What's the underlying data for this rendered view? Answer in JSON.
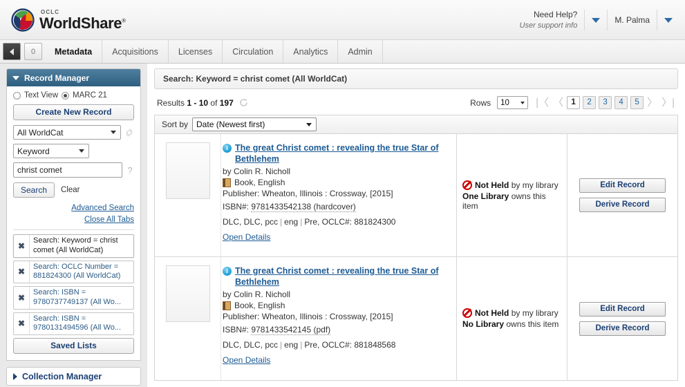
{
  "header": {
    "logo": {
      "brand_top": "OCLC",
      "brand_main": "WorldShare",
      "tm": "®"
    },
    "need_help": {
      "line1": "Need Help?",
      "line2": "User support info"
    },
    "user": "M. Palma",
    "chevron_icon": "chevron-down-icon"
  },
  "nav": {
    "collapse_icon": "chevron-left-icon",
    "counter": "0",
    "tabs": [
      {
        "label": "Metadata",
        "active": true
      },
      {
        "label": "Acquisitions",
        "active": false
      },
      {
        "label": "Licenses",
        "active": false
      },
      {
        "label": "Circulation",
        "active": false
      },
      {
        "label": "Analytics",
        "active": false
      },
      {
        "label": "Admin",
        "active": false
      }
    ]
  },
  "sidebar": {
    "record_manager": {
      "title": "Record Manager",
      "view_options": [
        {
          "label": "Text View",
          "selected": false
        },
        {
          "label": "MARC 21",
          "selected": true
        }
      ],
      "create_button": "Create New Record",
      "database_select": "All WorldCat",
      "gear_icon": "gear-icon",
      "index_select": "Keyword",
      "search_value": "christ comet",
      "help_icon": "question-mark-icon",
      "search_button": "Search",
      "clear_button": "Clear",
      "advanced_search": "Advanced Search",
      "close_all_tabs": "Close All Tabs",
      "saved_searches": [
        {
          "label": "Search: Keyword = christ comet (All WorldCat)",
          "active": true,
          "close_icon": "close-icon"
        },
        {
          "label": "Search: OCLC Number = 881824300 (All WorldCat)",
          "active": false,
          "close_icon": "close-icon"
        },
        {
          "label": "Search: ISBN = 9780737749137 (All Wo...",
          "active": false,
          "close_icon": "close-icon"
        },
        {
          "label": "Search: ISBN = 9780131494596 (All Wo...",
          "active": false,
          "close_icon": "close-icon"
        }
      ],
      "saved_lists_button": "Saved Lists"
    },
    "collection_manager": {
      "title": "Collection Manager",
      "expand_icon": "triangle-right-icon"
    }
  },
  "main": {
    "search_summary": "Search: Keyword = christ comet (All WorldCat)",
    "results_label_prefix": "Results",
    "results_range": "1 - 10",
    "results_of": "of",
    "results_total": "197",
    "refresh_icon": "refresh-icon",
    "rows_label": "Rows",
    "rows_value": "10",
    "pagination": {
      "first_icon": "first-page-icon",
      "prev_icon": "prev-page-icon",
      "pages": [
        "1",
        "2",
        "3",
        "4",
        "5"
      ],
      "current_page": "1",
      "next_icon": "next-page-icon",
      "last_icon": "last-page-icon"
    },
    "sort_label": "Sort by",
    "sort_value": "Date (Newest first)",
    "results": [
      {
        "info_icon": "info-icon",
        "cover_placeholder": "no-cover-image",
        "title": "The great Christ comet : revealing the true Star of Bethlehem",
        "author": "by Colin R. Nicholl",
        "format_icon": "book-icon",
        "format": "Book, English",
        "publisher": "Publisher: Wheaton, Illinois : Crossway, [2015]",
        "isbn_label": "ISBN#:",
        "isbn_value": "9781433542138 (hardcover)",
        "catalog_source": "DLC, DLC, pcc",
        "language": "eng",
        "encoding_level": "Pre,",
        "oclc_label": "OCLC#:",
        "oclc_number": "881824300",
        "open_details": "Open Details",
        "holdings_icon": "not-held-icon",
        "holdings_status_bold": "Not Held",
        "holdings_status_rest": "by my library",
        "holdings_count_bold": "One Library",
        "holdings_count_rest": "owns this item",
        "edit_button": "Edit Record",
        "derive_button": "Derive Record"
      },
      {
        "info_icon": "info-icon",
        "cover_placeholder": "no-cover-image",
        "title": "The great Christ comet : revealing the true Star of Bethlehem",
        "author": "by Colin R. Nicholl",
        "format_icon": "book-icon",
        "format": "Book, English",
        "publisher": "Publisher: Wheaton, Illinois : Crossway, [2015]",
        "isbn_label": "ISBN#:",
        "isbn_value": "9781433542145 (pdf)",
        "catalog_source": "DLC, DLC, pcc",
        "language": "eng",
        "encoding_level": "Pre,",
        "oclc_label": "OCLC#:",
        "oclc_number": "881848568",
        "open_details": "Open Details",
        "holdings_icon": "not-held-icon",
        "holdings_status_bold": "Not Held",
        "holdings_status_rest": "by my library",
        "holdings_count_bold": "No Library",
        "holdings_count_rest": "owns this item",
        "edit_button": "Edit Record",
        "derive_button": "Derive Record"
      }
    ]
  },
  "colors": {
    "panel_header": "#2f5f80",
    "link": "#1d5b94",
    "button_text": "#1b3f73",
    "alert_red": "#cc0000",
    "info_blue": "#2fa8d8"
  }
}
